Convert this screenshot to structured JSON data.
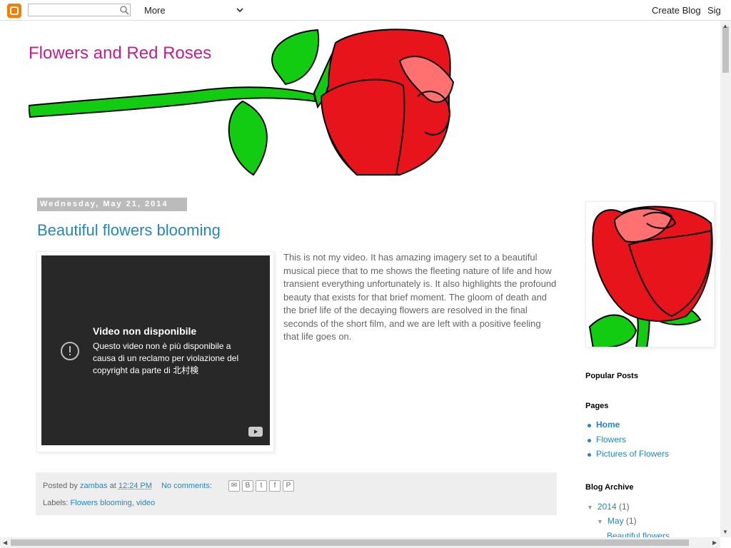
{
  "navbar": {
    "logo_icon": "blogger-icon",
    "search_placeholder": "",
    "more_label": "More",
    "create_blog": "Create Blog",
    "sign_in": "Sign In"
  },
  "header": {
    "title": "Flowers and Red Roses"
  },
  "post": {
    "date": "Wednesday, May 21, 2014",
    "title": "Beautiful flowers blooming",
    "video": {
      "title": "Video non disponibile",
      "message": "Questo video non è più disponibile a causa di un reclamo per violazione del copyright da parte di 北村検"
    },
    "body": "This is not my video. It has amazing imagery set to a beautiful musical piece that to me shows the fleeting nature of life and how transient everything unfortunately is. It also highlights the profound beauty that exists for that brief moment. The gloom of death and the brief life of the decaying flowers are resolved in the final seconds of the short film, and we are left with a positive feeling that life goes on.",
    "footer": {
      "posted_by": "Posted by",
      "author": "zambas",
      "at": "at",
      "time": "12:24 PM",
      "comments": "No comments:",
      "labels_label": "Labels:",
      "labels": [
        "Flowers blooming",
        "video"
      ],
      "share_icons": [
        "email-icon",
        "blogger-icon",
        "twitter-icon",
        "facebook-icon",
        "pinterest-icon"
      ]
    }
  },
  "sidebar": {
    "popular_posts": "Popular Posts",
    "pages_heading": "Pages",
    "pages": [
      "Home",
      "Flowers",
      "Pictures of Flowers"
    ],
    "archive_heading": "Blog Archive",
    "archive": {
      "year": "2014",
      "year_count": "(1)",
      "month": "May",
      "month_count": "(1)",
      "post": "Beautiful flowers"
    }
  },
  "colors": {
    "title": "#c11f8e",
    "link": "#2288bb",
    "rose": "#e8141c",
    "leaf": "#11cc11"
  }
}
